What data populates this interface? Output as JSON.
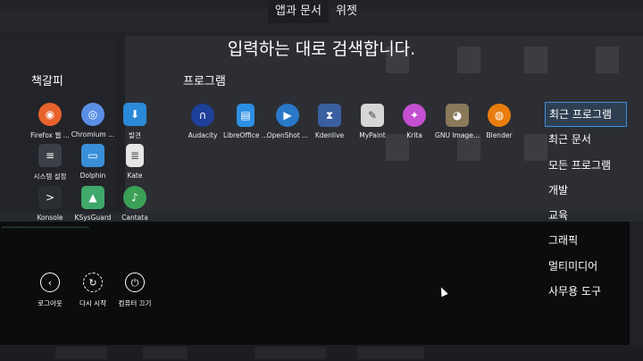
{
  "tabs": [
    {
      "label": "앱과 문서",
      "active": true
    },
    {
      "label": "위젯",
      "active": false
    }
  ],
  "search_hint": "입력하는 대로 검색합니다.",
  "favorites": {
    "title": "책갈피",
    "items": [
      {
        "label": "Firefox 웹 ...",
        "icon": "firefox-icon",
        "color": "#e8622c"
      },
      {
        "label": "Chromium ...",
        "icon": "chromium-icon",
        "color": "#5b8fe6"
      },
      {
        "label": "발견",
        "icon": "discover-icon",
        "color": "#2b8ad8"
      },
      {
        "label": "시스템 설정",
        "icon": "system-settings-icon",
        "color": "#3b3f46"
      },
      {
        "label": "Dolphin",
        "icon": "dolphin-icon",
        "color": "#3a8fd9"
      },
      {
        "label": "Kate",
        "icon": "kate-icon",
        "color": "#e6e6e6"
      },
      {
        "label": "Konsole",
        "icon": "konsole-icon",
        "color": "#2a2d31"
      },
      {
        "label": "KSysGuard",
        "icon": "ksysguard-icon",
        "color": "#3fa86a"
      },
      {
        "label": "Cantata",
        "icon": "cantata-icon",
        "color": "#3ba056"
      }
    ]
  },
  "programs": {
    "title": "프로그램",
    "items": [
      {
        "label": "Audacity",
        "icon": "audacity-icon",
        "color": "#1e3f9a"
      },
      {
        "label": "LibreOffice ...",
        "icon": "libreoffice-icon",
        "color": "#2d8fe3"
      },
      {
        "label": "OpenShot ...",
        "icon": "openshot-icon",
        "color": "#2a78c9"
      },
      {
        "label": "Kdenlive",
        "icon": "kdenlive-icon",
        "color": "#3a5fa0"
      },
      {
        "label": "MyPaint",
        "icon": "mypaint-icon",
        "color": "#d6d6d6"
      },
      {
        "label": "Krita",
        "icon": "krita-icon",
        "color": "#c44fd0"
      },
      {
        "label": "GNU Image...",
        "icon": "gimp-icon",
        "color": "#8a7a5a"
      },
      {
        "label": "Blender",
        "icon": "blender-icon",
        "color": "#e87d0d"
      }
    ]
  },
  "categories": [
    {
      "label": "최근 프로그램",
      "active": true
    },
    {
      "label": "최근 문서",
      "active": false
    },
    {
      "label": "모든 프로그램",
      "active": false
    },
    {
      "label": "개발",
      "active": false
    },
    {
      "label": "교육",
      "active": false
    },
    {
      "label": "그래픽",
      "active": false
    },
    {
      "label": "멀티미디어",
      "active": false
    },
    {
      "label": "사무용 도구",
      "active": false
    }
  ],
  "power": [
    {
      "label": "로그아웃",
      "icon": "logout-icon"
    },
    {
      "label": "다시 시작",
      "icon": "restart-icon"
    },
    {
      "label": "컴퓨터 끄기",
      "icon": "shutdown-icon"
    }
  ]
}
